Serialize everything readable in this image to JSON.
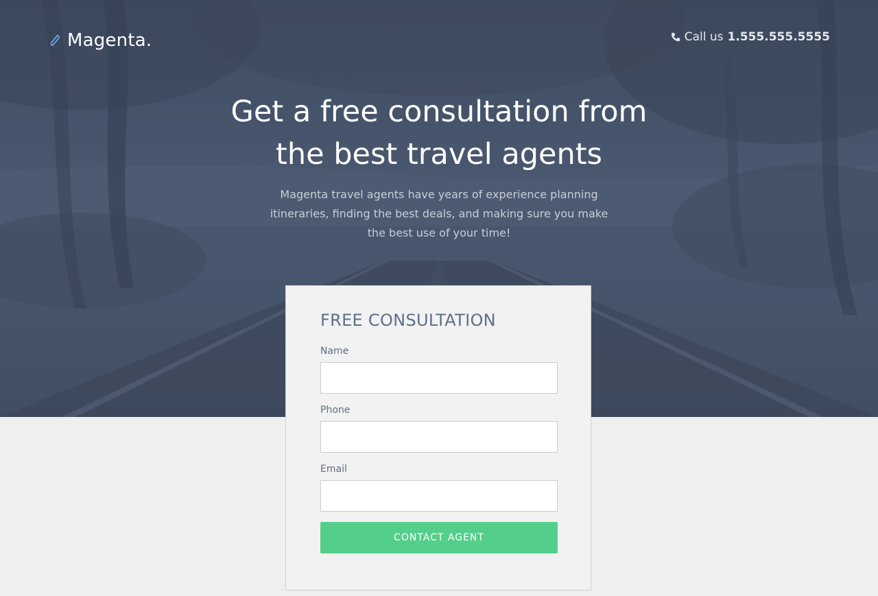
{
  "header": {
    "brand": "Magenta.",
    "call_prefix": "Call us",
    "phone_number": "1.555.555.5555"
  },
  "hero": {
    "headline": "Get a free consultation from the best travel agents",
    "subtext": "Magenta travel agents have years of experience planning itineraries, finding the best deals, and making sure you make the best use of your time!"
  },
  "form": {
    "title": "FREE CONSULTATION",
    "fields": [
      {
        "label": "Name",
        "value": "",
        "placeholder": ""
      },
      {
        "label": "Phone",
        "value": "",
        "placeholder": ""
      },
      {
        "label": "Email",
        "value": "",
        "placeholder": ""
      }
    ],
    "submit_label": "CONTACT AGENT"
  },
  "colors": {
    "overlay": "#4a5870",
    "accent_icon": "#6fa0dc",
    "button": "#53cf8b",
    "form_title": "#5e6f87",
    "page_bg": "#efefef"
  },
  "icons": {
    "logo": "paperclip-icon",
    "call": "phone-icon"
  }
}
